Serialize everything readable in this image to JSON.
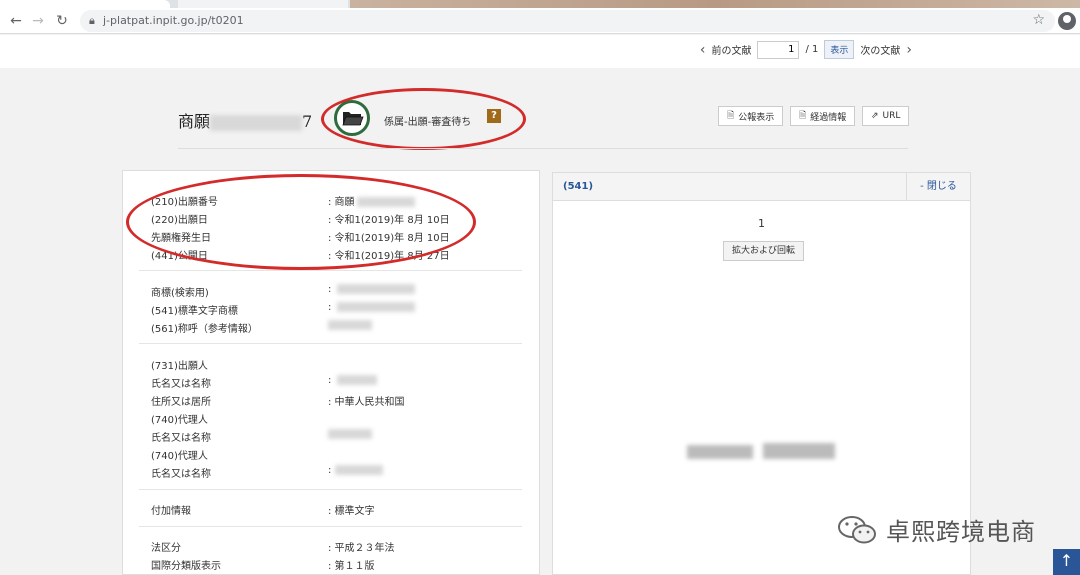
{
  "browser": {
    "url": "j-platpat.inpit.go.jp/t0201"
  },
  "pager": {
    "prev_label": "前の文献",
    "page_value": "1",
    "total": "/ 1",
    "show_label": "表示",
    "next_label": "次の文献"
  },
  "header": {
    "title_prefix": "商願",
    "title_suffix": "7",
    "status": "係属-出願-審査待ち",
    "help": "?",
    "buttons": [
      "公報表示",
      "経過情報",
      "URL"
    ]
  },
  "details": {
    "group1": [
      {
        "label": "(210)出願番号",
        "value": ": 商願"
      },
      {
        "label": "(220)出願日",
        "value": ": 令和1(2019)年 8月 10日"
      },
      {
        "label": "先願権発生日",
        "value": ": 令和1(2019)年 8月 10日"
      },
      {
        "label": "(441)公開日",
        "value": ": 令和1(2019)年 8月 27日"
      }
    ],
    "group2": [
      {
        "label": "商標(検索用)",
        "value": ":"
      },
      {
        "label": "(541)標準文字商標",
        "value": ":"
      },
      {
        "label": "(561)称呼（参考情報）",
        "value": ""
      }
    ],
    "group3": [
      {
        "label": "(731)出願人",
        "value": ""
      },
      {
        "label": "氏名又は名称",
        "value": ":"
      },
      {
        "label": "住所又は居所",
        "value": ": 中華人民共和国"
      },
      {
        "label": "(740)代理人",
        "value": ""
      },
      {
        "label": "氏名又は名称",
        "value": ""
      },
      {
        "label": "(740)代理人",
        "value": ""
      },
      {
        "label": "氏名又は名称",
        "value": ":"
      }
    ],
    "group4": [
      {
        "label": "付加情報",
        "value": ": 標準文字"
      }
    ],
    "group5": [
      {
        "label": "法区分",
        "value": ": 平成２３年法"
      },
      {
        "label": "国際分類版表示",
        "value": ": 第１１版"
      }
    ]
  },
  "right_panel": {
    "code": "(541)",
    "close_label": "- 閉じる",
    "page_number": "1",
    "zoom_label": "拡大および回転"
  },
  "watermark": {
    "text": "卓熙跨境电商"
  },
  "colors": {
    "accent": "#2a5698",
    "annotation": "#d32a2a",
    "folder_ring": "#2e6b3d"
  }
}
